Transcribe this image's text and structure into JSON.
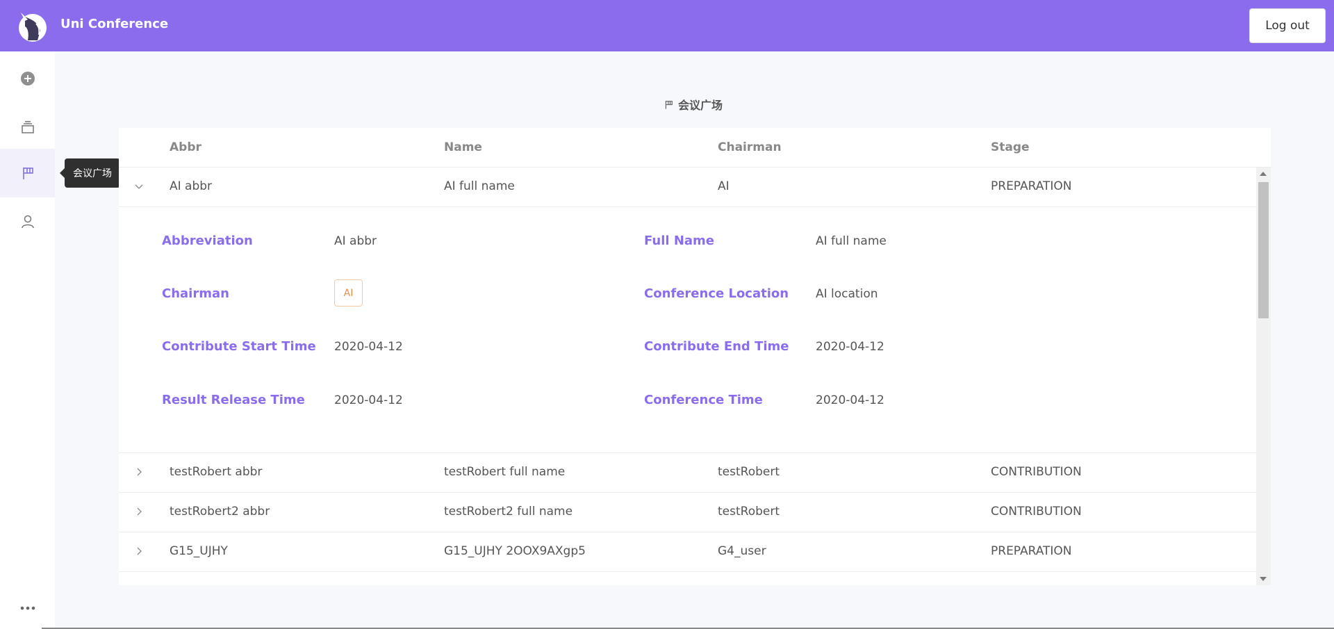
{
  "app": {
    "title": "Uni Conference",
    "logout_label": "Log out"
  },
  "sidebar": {
    "items": [
      {
        "icon": "plus-circle-icon",
        "label": ""
      },
      {
        "icon": "layers-icon",
        "label": ""
      },
      {
        "icon": "flag-icon",
        "label": "会议广场",
        "active": true
      },
      {
        "icon": "user-icon",
        "label": ""
      }
    ],
    "tooltip": "会议广场",
    "more_icon": "ellipsis-icon"
  },
  "page": {
    "title": "会议广场",
    "title_icon": "flag-icon"
  },
  "table": {
    "columns": [
      "Abbr",
      "Name",
      "Chairman",
      "Stage"
    ],
    "rows": [
      {
        "abbr": "AI abbr",
        "name": "AI full name",
        "chairman": "AI",
        "stage": "PREPARATION",
        "expanded": true
      },
      {
        "abbr": "testRobert abbr",
        "name": "testRobert full name",
        "chairman": "testRobert",
        "stage": "CONTRIBUTION"
      },
      {
        "abbr": "testRobert2 abbr",
        "name": "testRobert2 full name",
        "chairman": "testRobert",
        "stage": "CONTRIBUTION"
      },
      {
        "abbr": "G15_UJHY",
        "name": "G15_UJHY 2OOX9AXgp5",
        "chairman": "G4_user",
        "stage": "PREPARATION"
      }
    ],
    "details": {
      "abbreviation_label": "Abbreviation",
      "abbreviation": "AI abbr",
      "full_name_label": "Full Name",
      "full_name": "AI full name",
      "chairman_label": "Chairman",
      "chairman_tag": "AI",
      "location_label": "Conference Location",
      "location": "AI location",
      "contribute_start_label": "Contribute Start Time",
      "contribute_start": "2020-04-12",
      "contribute_end_label": "Contribute End Time",
      "contribute_end": "2020-04-12",
      "result_release_label": "Result Release Time",
      "result_release": "2020-04-12",
      "conference_time_label": "Conference Time",
      "conference_time": "2020-04-12"
    }
  },
  "colors": {
    "brand": "#8a6ced",
    "tag": "#ef8e4f"
  }
}
